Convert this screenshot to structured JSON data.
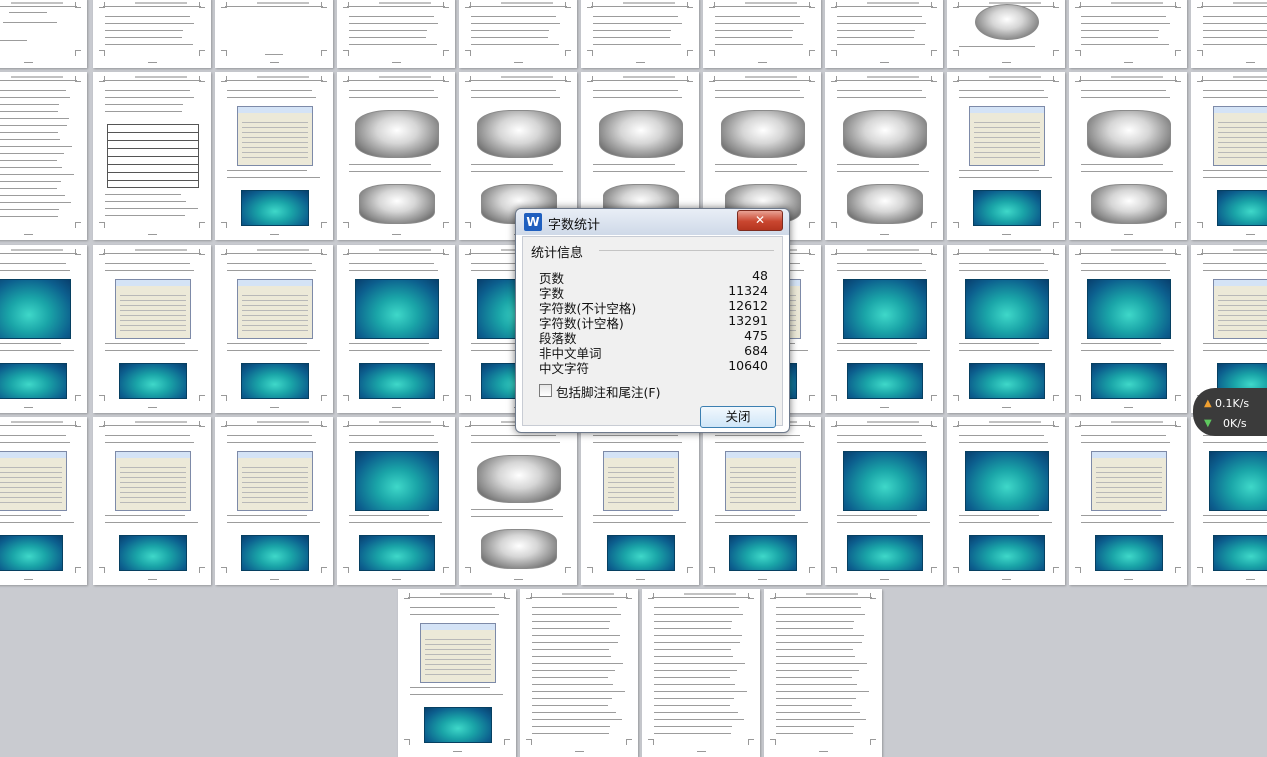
{
  "dialog": {
    "title": "字数统计",
    "app_icon": "W",
    "close_button": "✕",
    "group_label": "统计信息",
    "stats": [
      {
        "label": "页数",
        "value": "48"
      },
      {
        "label": "字数",
        "value": "11324"
      },
      {
        "label": "字符数(不计空格)",
        "value": "12612"
      },
      {
        "label": "字符数(计空格)",
        "value": "13291"
      },
      {
        "label": "段落数",
        "value": "475"
      },
      {
        "label": "非中文单词",
        "value": "684"
      },
      {
        "label": "中文字符",
        "value": "10640"
      }
    ],
    "checkbox_label": "包括脚注和尾注(F)",
    "checkbox_checked": false,
    "ok_button": "关闭"
  },
  "net_speed": {
    "upload": "0.1K/s",
    "download": "0K/s",
    "up_icon": "arrow-up-icon",
    "down_icon": "arrow-down-icon"
  },
  "pages": [
    {
      "type": "title"
    },
    {
      "type": "text"
    },
    {
      "type": "blank"
    },
    {
      "type": "text"
    },
    {
      "type": "text"
    },
    {
      "type": "text"
    },
    {
      "type": "text"
    },
    {
      "type": "text"
    },
    {
      "type": "drawing"
    },
    {
      "type": "text"
    },
    {
      "type": "text"
    },
    {
      "type": "text"
    },
    {
      "type": "table"
    },
    {
      "type": "dialog"
    },
    {
      "type": "render"
    },
    {
      "type": "render"
    },
    {
      "type": "render"
    },
    {
      "type": "render"
    },
    {
      "type": "render"
    },
    {
      "type": "dialog"
    },
    {
      "type": "render"
    },
    {
      "type": "dialog"
    },
    {
      "type": "sim"
    },
    {
      "type": "dialog"
    },
    {
      "type": "dialog"
    },
    {
      "type": "sim"
    },
    {
      "type": "sim"
    },
    {
      "type": "sim"
    },
    {
      "type": "dialog"
    },
    {
      "type": "sim"
    },
    {
      "type": "sim"
    },
    {
      "type": "sim"
    },
    {
      "type": "dialog"
    },
    {
      "type": "dialog"
    },
    {
      "type": "dialog"
    },
    {
      "type": "dialog"
    },
    {
      "type": "sim"
    },
    {
      "type": "render"
    },
    {
      "type": "dialog"
    },
    {
      "type": "dialog"
    },
    {
      "type": "sim"
    },
    {
      "type": "sim"
    },
    {
      "type": "dialog"
    },
    {
      "type": "sim"
    },
    {
      "type": "dialog"
    },
    {
      "type": "text"
    },
    {
      "type": "text"
    },
    {
      "type": "text"
    }
  ]
}
